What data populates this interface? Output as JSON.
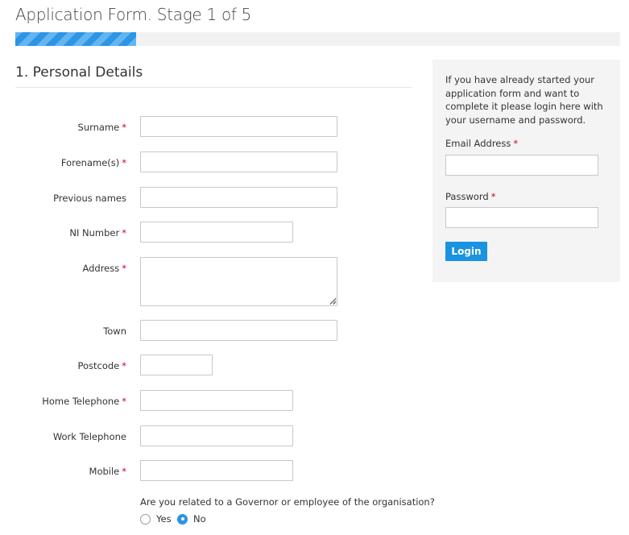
{
  "page": {
    "title": "Application Form. Stage 1 of 5",
    "progress_fraction": 0.2,
    "accent_color": "#2c95e4",
    "required_color": "#d0021b"
  },
  "section": {
    "title": "1. Personal Details"
  },
  "fields": {
    "surname": {
      "label": "Surname",
      "required": "*",
      "value": ""
    },
    "forenames": {
      "label": "Forename(s)",
      "required": "*",
      "value": ""
    },
    "previous_names": {
      "label": "Previous names",
      "value": ""
    },
    "ni_number": {
      "label": "NI Number",
      "required": "*",
      "value": ""
    },
    "address": {
      "label": "Address",
      "required": "*",
      "value": ""
    },
    "town": {
      "label": "Town",
      "value": ""
    },
    "postcode": {
      "label": "Postcode",
      "required": "*",
      "value": ""
    },
    "home_telephone": {
      "label": "Home Telephone",
      "required": "*",
      "value": ""
    },
    "work_telephone": {
      "label": "Work Telephone",
      "value": ""
    },
    "mobile": {
      "label": "Mobile",
      "required": "*",
      "value": ""
    }
  },
  "related_question": {
    "text": "Are you related to a Governor or employee of the organisation?",
    "options": [
      {
        "label": "Yes",
        "checked": false
      },
      {
        "label": "No",
        "checked": true
      }
    ]
  },
  "login_panel": {
    "intro": "If you have already started your application form and want to complete it please login here with your username and password.",
    "email_label": "Email Address",
    "password_label": "Password",
    "required": "*",
    "button_label": "Login"
  }
}
